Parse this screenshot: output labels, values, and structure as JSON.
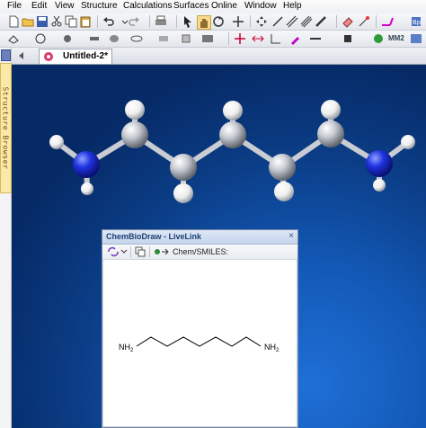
{
  "menubar": {
    "items": [
      "File",
      "Edit",
      "View",
      "Structure",
      "Calculations",
      "Surfaces",
      "Online",
      "Window",
      "Help"
    ]
  },
  "sidebar": {
    "label": "Structure Browser"
  },
  "document_tab": {
    "title": "Untitled-2*"
  },
  "toolbar_right": {
    "label": "MM2"
  },
  "livelink": {
    "title": "ChemBioDraw - LiveLink",
    "close_glyph": "×",
    "toolbar_label": "Chem/SMILES:",
    "structure": {
      "left_group": "NH",
      "left_sub": "2",
      "right_group": "NH",
      "right_sub": "2"
    }
  },
  "colors": {
    "carbon": "#b8bcc4",
    "hydrogen": "#f2f2f2",
    "nitrogen": "#1a2fd8",
    "canvas_dark": "#062a66",
    "canvas_light": "#1f6fd6"
  }
}
